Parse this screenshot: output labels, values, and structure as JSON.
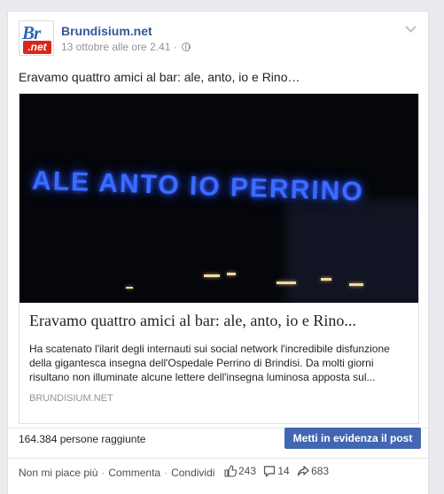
{
  "post": {
    "page_name": "Brundisium.net",
    "timestamp": "13 ottobre alle ore 2.41",
    "audience_icon": "globe-icon",
    "text": "Eravamo quattro amici al bar: ale, anto, io e Rino…"
  },
  "logo": {
    "top": "Br",
    "bottom": ".net"
  },
  "link": {
    "image_sign_text": "ALE ANTO IO PERRINO",
    "title": "Eravamo quattro amici al bar: ale, anto, io e Rino...",
    "description": "Ha scatenato l'ilarit degli internauti sui social network l'incredibile disfunzione della gigantesca insegna dell'Ospedale Perrino di Brindisi. Da molti giorni risultano non illuminate alcune lettere dell'insegna luminosa apposta sul...",
    "domain": "BRUNDISIUM.NET"
  },
  "insights": {
    "reach": "164.384 persone raggiunte",
    "boost_label": "Metti in evidenza il post"
  },
  "actions": {
    "unlike": "Non mi piace più",
    "comment": "Commenta",
    "share": "Condividi",
    "separator": "·"
  },
  "counts": {
    "likes": "243",
    "comments": "14",
    "shares": "683"
  },
  "colors": {
    "link_blue": "#365899",
    "button_blue": "#4267b2",
    "neon_blue": "#3b6bff"
  }
}
